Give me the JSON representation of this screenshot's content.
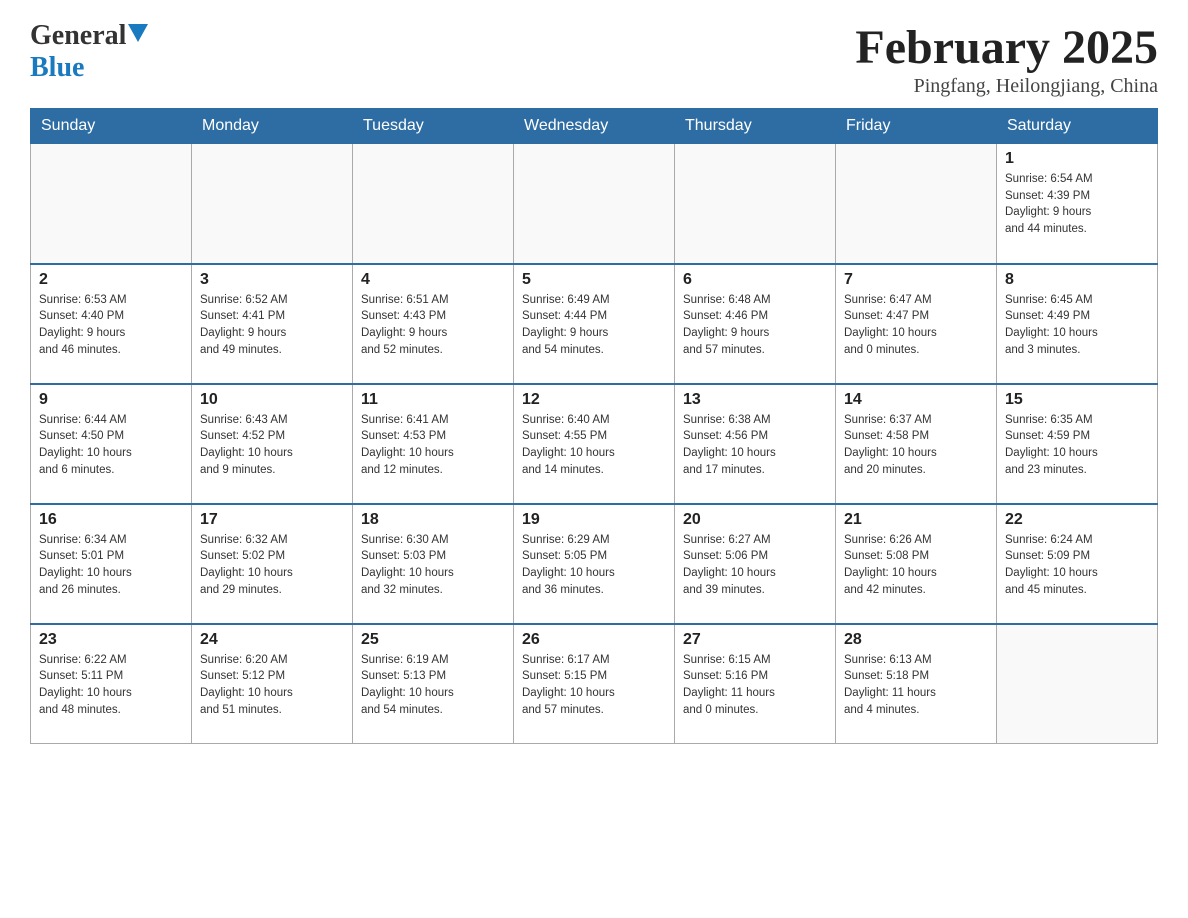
{
  "header": {
    "logo_general": "General",
    "logo_blue": "Blue",
    "month_title": "February 2025",
    "location": "Pingfang, Heilongjiang, China"
  },
  "weekdays": [
    "Sunday",
    "Monday",
    "Tuesday",
    "Wednesday",
    "Thursday",
    "Friday",
    "Saturday"
  ],
  "weeks": [
    [
      {
        "day": "",
        "info": ""
      },
      {
        "day": "",
        "info": ""
      },
      {
        "day": "",
        "info": ""
      },
      {
        "day": "",
        "info": ""
      },
      {
        "day": "",
        "info": ""
      },
      {
        "day": "",
        "info": ""
      },
      {
        "day": "1",
        "info": "Sunrise: 6:54 AM\nSunset: 4:39 PM\nDaylight: 9 hours\nand 44 minutes."
      }
    ],
    [
      {
        "day": "2",
        "info": "Sunrise: 6:53 AM\nSunset: 4:40 PM\nDaylight: 9 hours\nand 46 minutes."
      },
      {
        "day": "3",
        "info": "Sunrise: 6:52 AM\nSunset: 4:41 PM\nDaylight: 9 hours\nand 49 minutes."
      },
      {
        "day": "4",
        "info": "Sunrise: 6:51 AM\nSunset: 4:43 PM\nDaylight: 9 hours\nand 52 minutes."
      },
      {
        "day": "5",
        "info": "Sunrise: 6:49 AM\nSunset: 4:44 PM\nDaylight: 9 hours\nand 54 minutes."
      },
      {
        "day": "6",
        "info": "Sunrise: 6:48 AM\nSunset: 4:46 PM\nDaylight: 9 hours\nand 57 minutes."
      },
      {
        "day": "7",
        "info": "Sunrise: 6:47 AM\nSunset: 4:47 PM\nDaylight: 10 hours\nand 0 minutes."
      },
      {
        "day": "8",
        "info": "Sunrise: 6:45 AM\nSunset: 4:49 PM\nDaylight: 10 hours\nand 3 minutes."
      }
    ],
    [
      {
        "day": "9",
        "info": "Sunrise: 6:44 AM\nSunset: 4:50 PM\nDaylight: 10 hours\nand 6 minutes."
      },
      {
        "day": "10",
        "info": "Sunrise: 6:43 AM\nSunset: 4:52 PM\nDaylight: 10 hours\nand 9 minutes."
      },
      {
        "day": "11",
        "info": "Sunrise: 6:41 AM\nSunset: 4:53 PM\nDaylight: 10 hours\nand 12 minutes."
      },
      {
        "day": "12",
        "info": "Sunrise: 6:40 AM\nSunset: 4:55 PM\nDaylight: 10 hours\nand 14 minutes."
      },
      {
        "day": "13",
        "info": "Sunrise: 6:38 AM\nSunset: 4:56 PM\nDaylight: 10 hours\nand 17 minutes."
      },
      {
        "day": "14",
        "info": "Sunrise: 6:37 AM\nSunset: 4:58 PM\nDaylight: 10 hours\nand 20 minutes."
      },
      {
        "day": "15",
        "info": "Sunrise: 6:35 AM\nSunset: 4:59 PM\nDaylight: 10 hours\nand 23 minutes."
      }
    ],
    [
      {
        "day": "16",
        "info": "Sunrise: 6:34 AM\nSunset: 5:01 PM\nDaylight: 10 hours\nand 26 minutes."
      },
      {
        "day": "17",
        "info": "Sunrise: 6:32 AM\nSunset: 5:02 PM\nDaylight: 10 hours\nand 29 minutes."
      },
      {
        "day": "18",
        "info": "Sunrise: 6:30 AM\nSunset: 5:03 PM\nDaylight: 10 hours\nand 32 minutes."
      },
      {
        "day": "19",
        "info": "Sunrise: 6:29 AM\nSunset: 5:05 PM\nDaylight: 10 hours\nand 36 minutes."
      },
      {
        "day": "20",
        "info": "Sunrise: 6:27 AM\nSunset: 5:06 PM\nDaylight: 10 hours\nand 39 minutes."
      },
      {
        "day": "21",
        "info": "Sunrise: 6:26 AM\nSunset: 5:08 PM\nDaylight: 10 hours\nand 42 minutes."
      },
      {
        "day": "22",
        "info": "Sunrise: 6:24 AM\nSunset: 5:09 PM\nDaylight: 10 hours\nand 45 minutes."
      }
    ],
    [
      {
        "day": "23",
        "info": "Sunrise: 6:22 AM\nSunset: 5:11 PM\nDaylight: 10 hours\nand 48 minutes."
      },
      {
        "day": "24",
        "info": "Sunrise: 6:20 AM\nSunset: 5:12 PM\nDaylight: 10 hours\nand 51 minutes."
      },
      {
        "day": "25",
        "info": "Sunrise: 6:19 AM\nSunset: 5:13 PM\nDaylight: 10 hours\nand 54 minutes."
      },
      {
        "day": "26",
        "info": "Sunrise: 6:17 AM\nSunset: 5:15 PM\nDaylight: 10 hours\nand 57 minutes."
      },
      {
        "day": "27",
        "info": "Sunrise: 6:15 AM\nSunset: 5:16 PM\nDaylight: 11 hours\nand 0 minutes."
      },
      {
        "day": "28",
        "info": "Sunrise: 6:13 AM\nSunset: 5:18 PM\nDaylight: 11 hours\nand 4 minutes."
      },
      {
        "day": "",
        "info": ""
      }
    ]
  ]
}
